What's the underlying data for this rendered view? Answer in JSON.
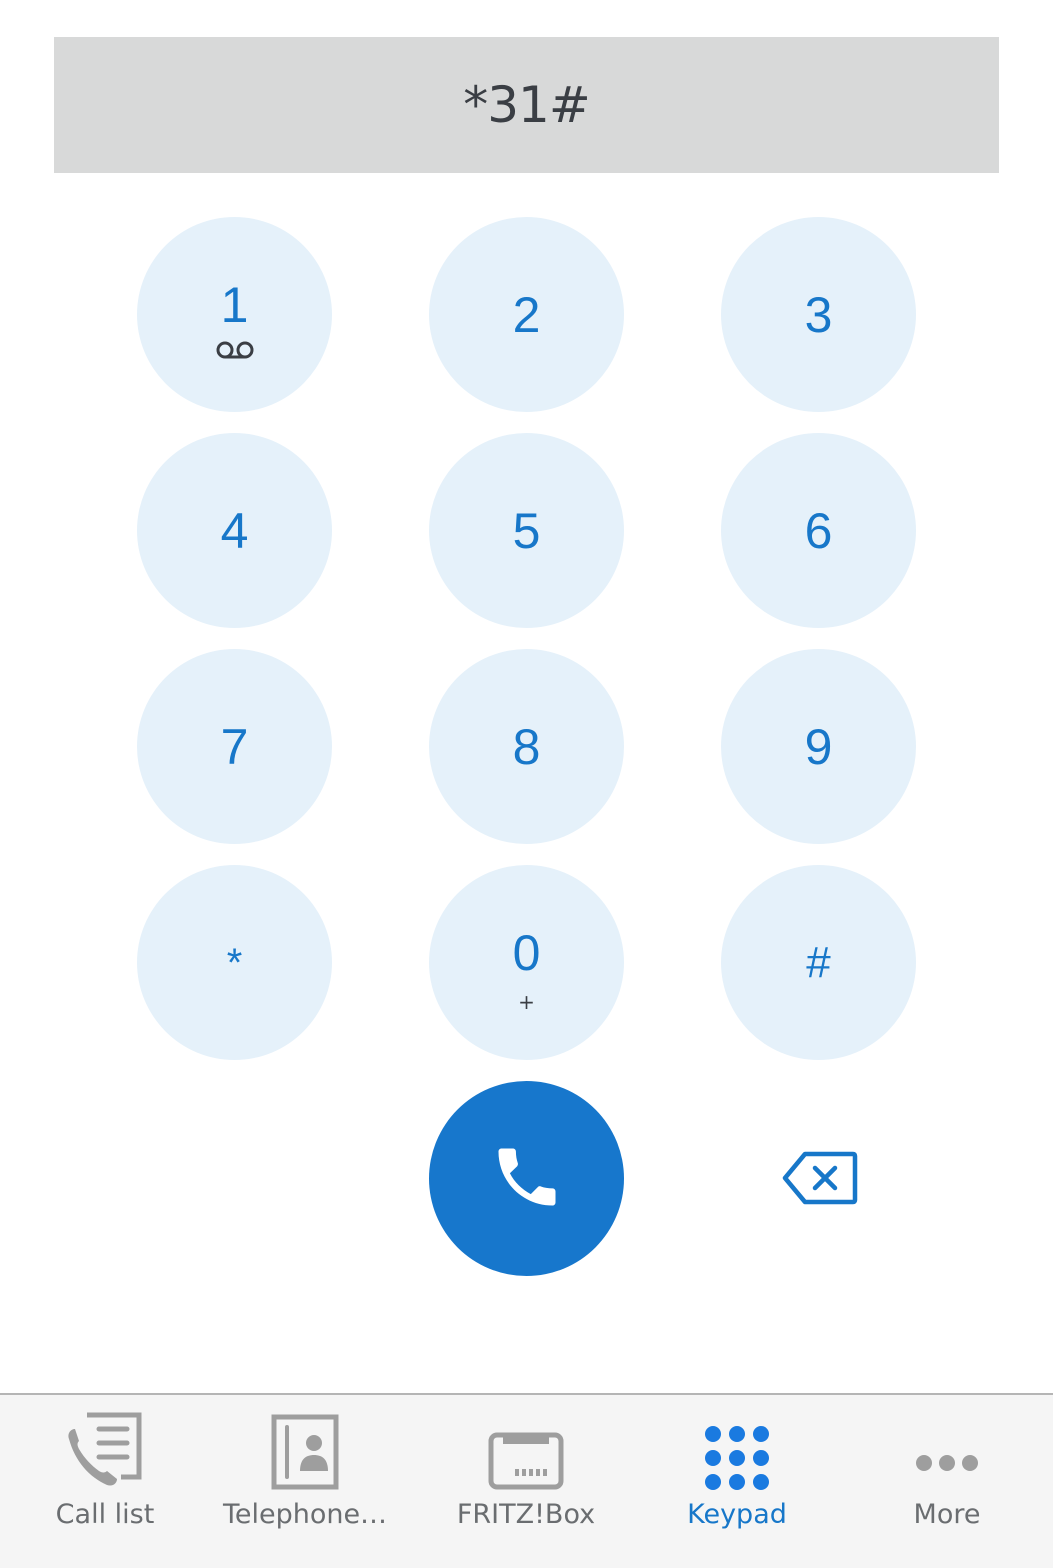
{
  "display": {
    "value": "*31#"
  },
  "keypad": {
    "keys": [
      {
        "digit": "1",
        "sub_icon": "voicemail-icon"
      },
      {
        "digit": "2"
      },
      {
        "digit": "3"
      },
      {
        "digit": "4"
      },
      {
        "digit": "5"
      },
      {
        "digit": "6"
      },
      {
        "digit": "7"
      },
      {
        "digit": "8"
      },
      {
        "digit": "9"
      },
      {
        "digit": "*"
      },
      {
        "digit": "0",
        "sub": "+"
      },
      {
        "digit": "#"
      }
    ],
    "call_icon": "phone-icon",
    "backspace_icon": "backspace-icon"
  },
  "tabbar": {
    "active": "Keypad",
    "items": [
      {
        "label": "Call list",
        "icon": "call-list-icon"
      },
      {
        "label": "Telephone…",
        "icon": "phonebook-icon"
      },
      {
        "label": "FRITZ!Box",
        "icon": "fritzbox-icon"
      },
      {
        "label": "Keypad",
        "icon": "keypad-icon"
      },
      {
        "label": "More",
        "icon": "more-icon"
      }
    ]
  },
  "colors": {
    "accent": "#1777c9",
    "key_bg": "#e5f1fa",
    "inactive": "#9e9e9e",
    "display_bg": "#d8d9d9"
  }
}
